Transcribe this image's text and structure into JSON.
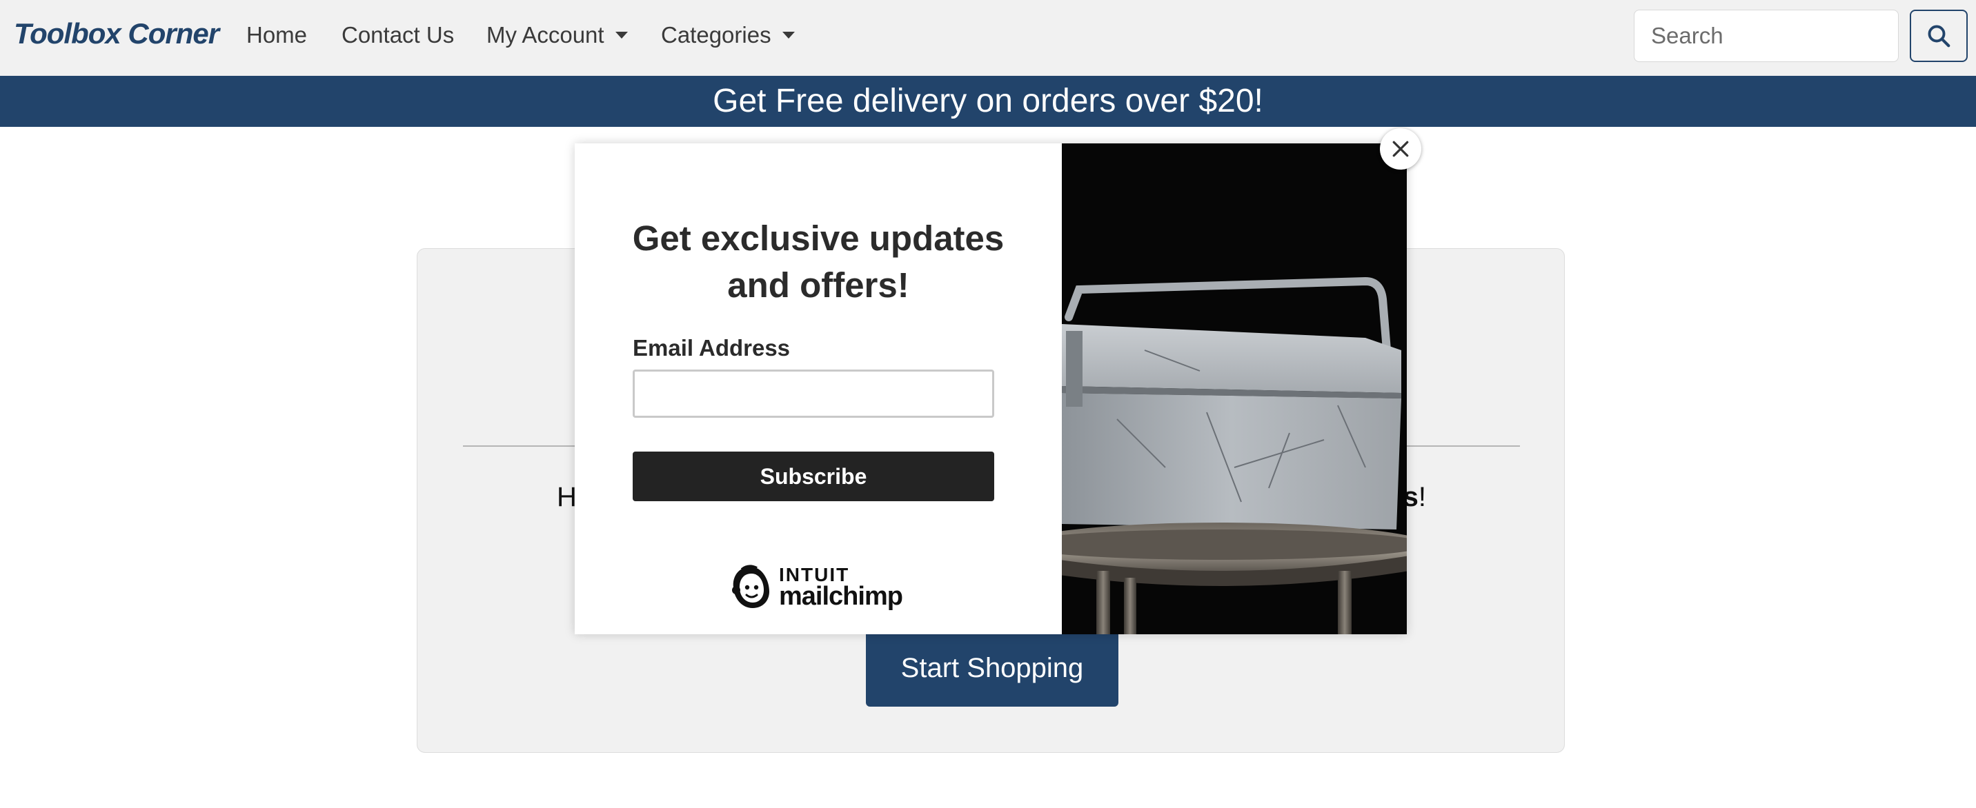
{
  "navbar": {
    "brand": "Toolbox Corner",
    "links": [
      {
        "label": "Home"
      },
      {
        "label": "Contact Us"
      },
      {
        "label": "My Account",
        "dropdown": true
      },
      {
        "label": "Categories",
        "dropdown": true
      }
    ],
    "search_placeholder": "Search",
    "search_icon": "search-icon"
  },
  "banner": {
    "text": "Get Free delivery on orders over $20!"
  },
  "card": {
    "text_start": "Here ",
    "text_bold_tail": "jects",
    "text_end": "!",
    "button_label": "Start Shopping"
  },
  "popup": {
    "title": "Get exclusive updates and offers!",
    "email_label": "Email Address",
    "email_value": "",
    "subscribe_label": "Subscribe",
    "logo_brand_top": "INTUIT",
    "logo_brand_bottom": "mailchimp",
    "close_icon": "close-icon",
    "image_subject": "toolbox-photo"
  },
  "colors": {
    "brand_blue": "#22446b",
    "navbar_bg": "#f1f1f1",
    "subscribe_bg": "#232323"
  }
}
